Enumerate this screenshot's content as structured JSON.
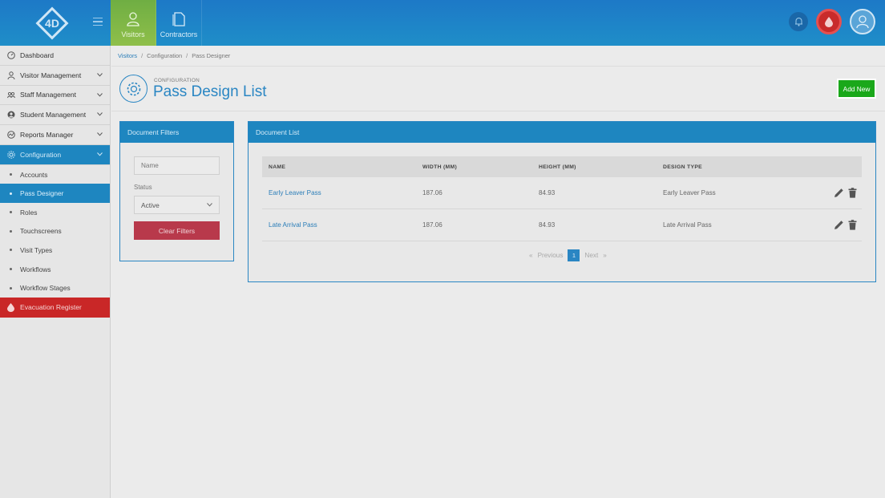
{
  "topnav": {
    "items": [
      {
        "label": "Visitors",
        "icon": "visitor-icon",
        "active": true
      },
      {
        "label": "Contractors",
        "icon": "document-icon",
        "active": false
      }
    ]
  },
  "sidebar": {
    "items": [
      {
        "label": "Dashboard",
        "icon": "dashboard-icon"
      },
      {
        "label": "Visitor Management",
        "icon": "person-icon"
      },
      {
        "label": "Staff Management",
        "icon": "group-icon"
      },
      {
        "label": "Student Management",
        "icon": "student-icon"
      },
      {
        "label": "Reports Manager",
        "icon": "chart-icon"
      },
      {
        "label": "Configuration",
        "icon": "gear-icon"
      }
    ],
    "sub_items": [
      {
        "label": "Accounts"
      },
      {
        "label": "Pass Designer"
      },
      {
        "label": "Roles"
      },
      {
        "label": "Touchscreens"
      },
      {
        "label": "Visit Types"
      },
      {
        "label": "Workflows"
      },
      {
        "label": "Workflow Stages"
      }
    ],
    "evacuation": {
      "label": "Evacuation Register"
    }
  },
  "breadcrumb": [
    "Visitors",
    "Configuration",
    "Pass Designer"
  ],
  "page": {
    "subtitle": "CONFIGURATION",
    "title": "Pass Design List",
    "add_button": "Add New"
  },
  "filters": {
    "title": "Document Filters",
    "name_placeholder": "Name",
    "status_label": "Status",
    "status_value": "Active",
    "clear_button": "Clear Filters"
  },
  "doclist": {
    "title": "Document List",
    "columns": [
      "NAME",
      "WIDTH (MM)",
      "HEIGHT (MM)",
      "DESIGN TYPE"
    ],
    "rows": [
      {
        "name": "Early Leaver Pass",
        "width": "187.06",
        "height": "84.93",
        "design_type": "Early Leaver Pass"
      },
      {
        "name": "Late Arrival Pass",
        "width": "187.06",
        "height": "84.93",
        "design_type": "Late Arrival Pass"
      }
    ],
    "pager": {
      "first": "«",
      "previous": "Previous",
      "page": "1",
      "next": "Next",
      "last": "»"
    }
  },
  "colors": {
    "brand_blue": "#1e86c0",
    "accent_green": "#1aa81a",
    "danger_red": "#c92727"
  }
}
